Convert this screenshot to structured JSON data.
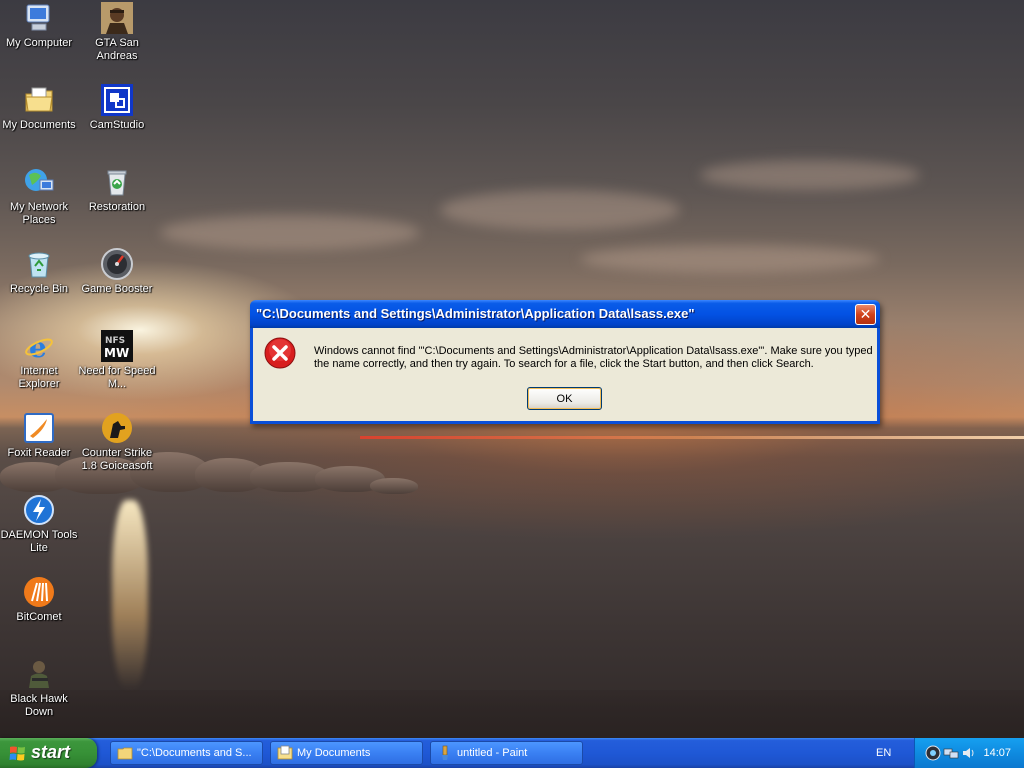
{
  "desktop_icons": [
    {
      "label": "My Computer",
      "icon": "my-computer-icon"
    },
    {
      "label": "GTA San Andreas",
      "icon": "gta-san-andreas-icon"
    },
    {
      "label": "My Documents",
      "icon": "my-documents-icon"
    },
    {
      "label": "CamStudio",
      "icon": "camstudio-icon"
    },
    {
      "label": "My Network Places",
      "icon": "network-places-icon"
    },
    {
      "label": "Restoration",
      "icon": "restoration-icon"
    },
    {
      "label": "Recycle Bin",
      "icon": "recycle-bin-icon"
    },
    {
      "label": "Game Booster",
      "icon": "game-booster-icon"
    },
    {
      "label": "Internet Explorer",
      "icon": "internet-explorer-icon"
    },
    {
      "label": "Need for Speed M...",
      "icon": "need-for-speed-icon"
    },
    {
      "label": "Foxit Reader",
      "icon": "foxit-reader-icon"
    },
    {
      "label": "Counter Strike 1.8 Goiceasoft",
      "icon": "counter-strike-icon"
    },
    {
      "label": "DAEMON Tools Lite",
      "icon": "daemon-tools-icon"
    },
    {
      "label": "BitComet",
      "icon": "bitcomet-icon"
    },
    {
      "label": "Black Hawk Down",
      "icon": "black-hawk-down-icon"
    }
  ],
  "dialog": {
    "title": "\"C:\\Documents and Settings\\Administrator\\Application Data\\lsass.exe\"",
    "message": "Windows cannot find '\"C:\\Documents and Settings\\Administrator\\Application Data\\lsass.exe\"'. Make sure you typed the name correctly, and then try again. To search for a file, click the Start button, and then click Search.",
    "ok_label": "OK",
    "close_glyph": "✕",
    "icon": "error-icon"
  },
  "taskbar": {
    "start_label": "start",
    "tasks": [
      {
        "label": "\"C:\\Documents and S...",
        "icon": "folder-icon"
      },
      {
        "label": "My Documents",
        "icon": "my-documents-icon"
      },
      {
        "label": "untitled - Paint",
        "icon": "paint-icon"
      }
    ],
    "language": "EN",
    "clock": "14:07"
  },
  "colors": {
    "titlebar_blue": "#0352e4",
    "taskbar_blue": "#245edb",
    "start_green": "#379137",
    "dialog_face": "#ece9d8",
    "error_red": "#d81e1e"
  }
}
